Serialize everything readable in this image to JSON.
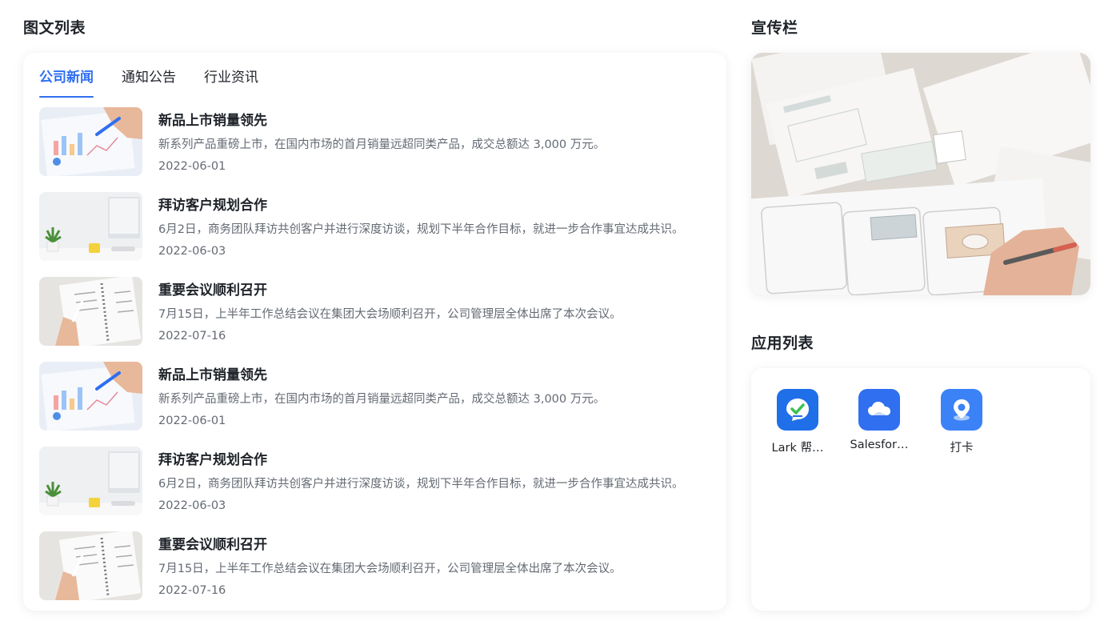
{
  "news_section": {
    "title": "图文列表",
    "tabs": [
      {
        "label": "公司新闻",
        "active": true
      },
      {
        "label": "通知公告",
        "active": false
      },
      {
        "label": "行业资讯",
        "active": false
      }
    ],
    "items": [
      {
        "title": "新品上市销量领先",
        "summary": "新系列产品重磅上市，在国内市场的首月销量远超同类产品，成交总额达 3,000 万元。",
        "date": "2022-06-01",
        "thumb": "chart-analysis"
      },
      {
        "title": "拜访客户规划合作",
        "summary": "6月2日，商务团队拜访共创客户并进行深度访谈，规划下半年合作目标，就进一步合作事宜达成共识。",
        "date": "2022-06-03",
        "thumb": "desk-plant"
      },
      {
        "title": "重要会议顺利召开",
        "summary": "7月15日，上半年工作总结会议在集团大会场顺利召开，公司管理层全体出席了本次会议。",
        "date": "2022-07-16",
        "thumb": "notebook-writing"
      },
      {
        "title": "新品上市销量领先",
        "summary": "新系列产品重磅上市，在国内市场的首月销量远超同类产品，成交总额达 3,000 万元。",
        "date": "2022-06-01",
        "thumb": "chart-analysis"
      },
      {
        "title": "拜访客户规划合作",
        "summary": "6月2日，商务团队拜访共创客户并进行深度访谈，规划下半年合作目标，就进一步合作事宜达成共识。",
        "date": "2022-06-03",
        "thumb": "desk-plant"
      },
      {
        "title": "重要会议顺利召开",
        "summary": "7月15日，上半年工作总结会议在集团大会场顺利召开，公司管理层全体出席了本次会议。",
        "date": "2022-07-16",
        "thumb": "notebook-writing"
      }
    ]
  },
  "banner_section": {
    "title": "宣传栏"
  },
  "apps_section": {
    "title": "应用列表",
    "apps": [
      {
        "name": "Lark 帮…",
        "icon": "lark-help-icon",
        "color": "#1f6fe8"
      },
      {
        "name": "Salesfor…",
        "icon": "cloud-icon",
        "color": "#2f6ff0"
      },
      {
        "name": "打卡",
        "icon": "location-pin-icon",
        "color": "#3b82f6"
      }
    ]
  },
  "colors": {
    "accent": "#2f6ff0",
    "text_primary": "#1f2329",
    "text_secondary": "#646a73"
  }
}
